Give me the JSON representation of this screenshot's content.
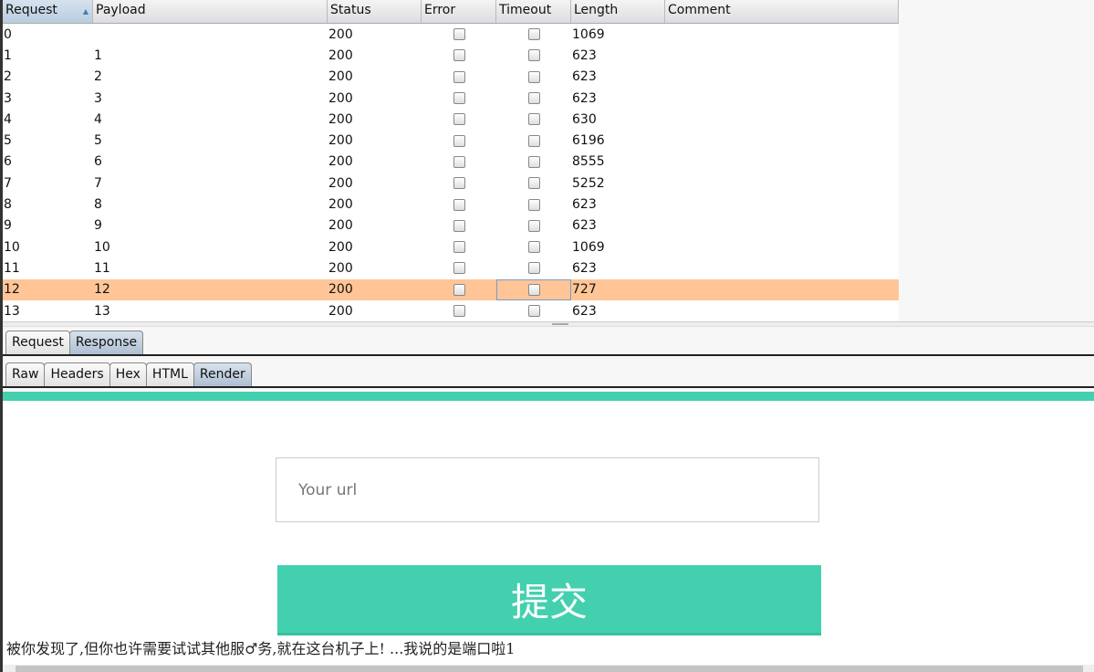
{
  "table": {
    "columns": [
      "Request",
      "Payload",
      "Status",
      "Error",
      "Timeout",
      "Length",
      "Comment"
    ],
    "rows": [
      {
        "request": "0",
        "payload": "",
        "status": "200",
        "length": "1069",
        "comment": ""
      },
      {
        "request": "1",
        "payload": "1",
        "status": "200",
        "length": "623",
        "comment": ""
      },
      {
        "request": "2",
        "payload": "2",
        "status": "200",
        "length": "623",
        "comment": ""
      },
      {
        "request": "3",
        "payload": "3",
        "status": "200",
        "length": "623",
        "comment": ""
      },
      {
        "request": "4",
        "payload": "4",
        "status": "200",
        "length": "630",
        "comment": ""
      },
      {
        "request": "5",
        "payload": "5",
        "status": "200",
        "length": "6196",
        "comment": ""
      },
      {
        "request": "6",
        "payload": "6",
        "status": "200",
        "length": "8555",
        "comment": ""
      },
      {
        "request": "7",
        "payload": "7",
        "status": "200",
        "length": "5252",
        "comment": ""
      },
      {
        "request": "8",
        "payload": "8",
        "status": "200",
        "length": "623",
        "comment": ""
      },
      {
        "request": "9",
        "payload": "9",
        "status": "200",
        "length": "623",
        "comment": ""
      },
      {
        "request": "10",
        "payload": "10",
        "status": "200",
        "length": "1069",
        "comment": ""
      },
      {
        "request": "11",
        "payload": "11",
        "status": "200",
        "length": "623",
        "comment": ""
      },
      {
        "request": "12",
        "payload": "12",
        "status": "200",
        "length": "727",
        "comment": "",
        "selected": true
      },
      {
        "request": "13",
        "payload": "13",
        "status": "200",
        "length": "623",
        "comment": ""
      }
    ],
    "highlight_color": "#ffc597"
  },
  "tabs": [
    "Request",
    "Response"
  ],
  "subtabs": [
    "Raw",
    "Headers",
    "Hex",
    "HTML",
    "Render"
  ],
  "render": {
    "url_placeholder": "Your url",
    "submit_label": "提交",
    "message": "被你发现了,但你也许需要试试其他服♂务,就在这台机子上! ...我说的是端口啦1",
    "accent": "#43d0ae"
  }
}
